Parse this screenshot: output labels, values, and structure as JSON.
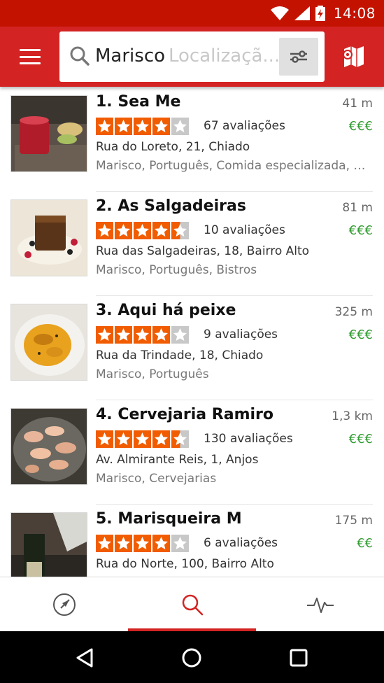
{
  "status_bar": {
    "time": "14:08"
  },
  "search": {
    "query": "Marisco",
    "location_placeholder": "Localizaçã..."
  },
  "colors": {
    "brand_red": "#d32323",
    "status_red": "#c41200",
    "star_orange": "#f15c00",
    "price_green": "#2f9c2f"
  },
  "results": [
    {
      "title": "1. Sea Me",
      "distance": "41 m",
      "rating": 4,
      "reviews": "67 avaliações",
      "price": "€€€",
      "address": "Rua do Loreto, 21, Chiado",
      "categories": "Marisco, Português, Comida especializada, Su..."
    },
    {
      "title": "2. As Salgadeiras",
      "distance": "81 m",
      "rating": 4.5,
      "reviews": "10 avaliações",
      "price": "€€€",
      "address": "Rua das Salgadeiras, 18, Bairro Alto",
      "categories": "Marisco, Português, Bistros"
    },
    {
      "title": "3. Aqui há peixe",
      "distance": "325 m",
      "rating": 4,
      "reviews": "9 avaliações",
      "price": "€€€",
      "address": "Rua da Trindade, 18, Chiado",
      "categories": "Marisco, Português"
    },
    {
      "title": "4. Cervejaria Ramiro",
      "distance": "1,3 km",
      "rating": 4.5,
      "reviews": "130 avaliações",
      "price": "€€€",
      "address": "Av. Almirante Reis, 1, Anjos",
      "categories": "Marisco, Cervejarias"
    },
    {
      "title": "5. Marisqueira M",
      "distance": "175 m",
      "rating": 4,
      "reviews": "6 avaliações",
      "price": "€€",
      "address": "Rua do Norte, 100, Bairro Alto",
      "categories": ""
    }
  ],
  "bottom_nav": [
    {
      "icon": "navigation-icon",
      "active": false
    },
    {
      "icon": "search-icon",
      "active": true
    },
    {
      "icon": "activity-icon",
      "active": false
    }
  ],
  "system_nav": [
    "back-icon",
    "home-icon",
    "recents-icon"
  ]
}
